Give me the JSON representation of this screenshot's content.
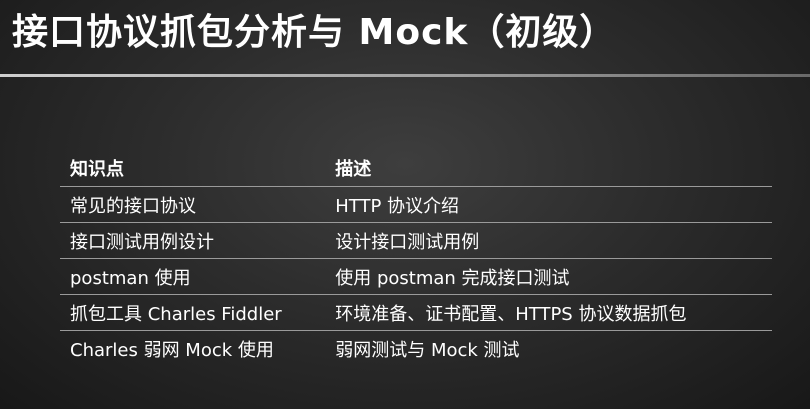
{
  "slide": {
    "title": "接口协议抓包分析与 Mock（初级）"
  },
  "table": {
    "headers": [
      "知识点",
      "描述"
    ],
    "rows": [
      [
        "常见的接口协议",
        "HTTP 协议介绍"
      ],
      [
        "接口测试用例设计",
        "设计接口测试用例"
      ],
      [
        "postman 使用",
        "使用 postman 完成接口测试"
      ],
      [
        "抓包工具 Charles Fiddler",
        "环境准备、证书配置、HTTPS 协议数据抓包"
      ],
      [
        "Charles 弱网 Mock 使用",
        "弱网测试与 Mock 测试"
      ]
    ]
  }
}
